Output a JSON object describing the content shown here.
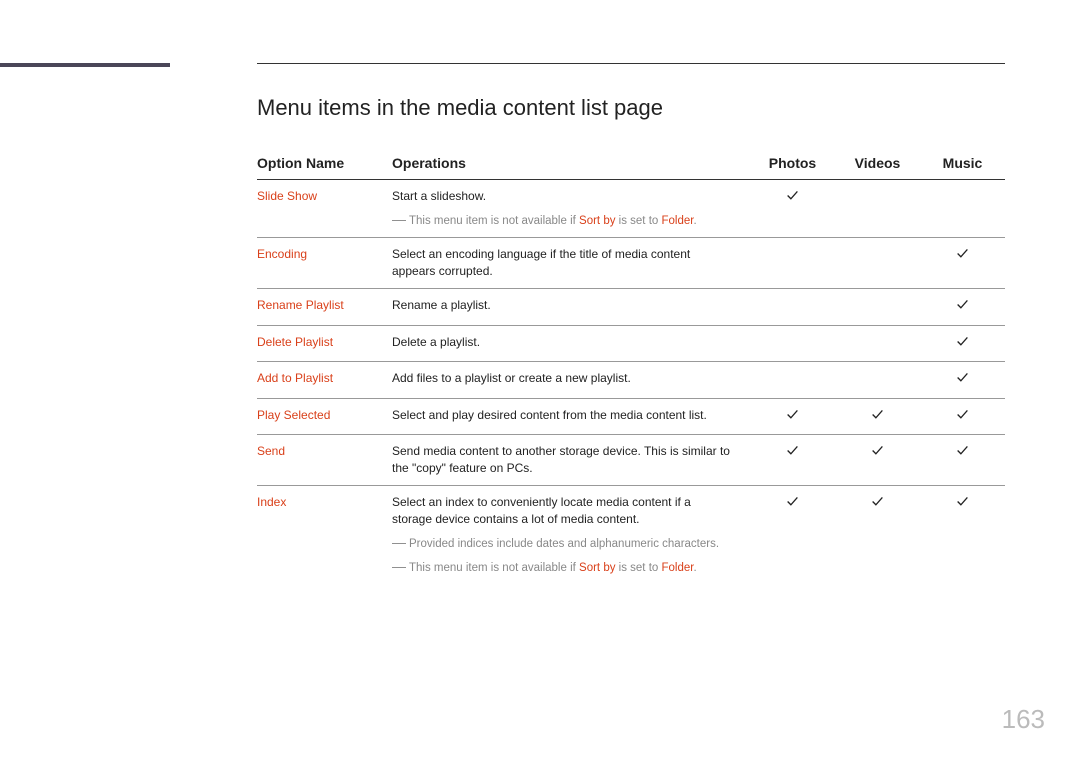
{
  "page": {
    "title": "Menu items in the media content list page",
    "pageNumber": "163"
  },
  "table": {
    "headers": {
      "optionName": "Option Name",
      "operations": "Operations",
      "photos": "Photos",
      "videos": "Videos",
      "music": "Music"
    },
    "rows": [
      {
        "name": "Slide Show",
        "desc": "Start a slideshow.",
        "notes": [
          {
            "prefix": "This menu item is not available if ",
            "hl1": "Sort by",
            "mid": " is set to ",
            "hl2": "Folder",
            "suffix": "."
          }
        ],
        "photos": true,
        "videos": false,
        "music": false
      },
      {
        "name": "Encoding",
        "desc": "Select an encoding language if the title of media content appears corrupted.",
        "notes": [],
        "photos": false,
        "videos": false,
        "music": true
      },
      {
        "name": "Rename Playlist",
        "desc": "Rename a playlist.",
        "notes": [],
        "photos": false,
        "videos": false,
        "music": true
      },
      {
        "name": "Delete Playlist",
        "desc": "Delete a playlist.",
        "notes": [],
        "photos": false,
        "videos": false,
        "music": true
      },
      {
        "name": "Add to Playlist",
        "desc": "Add files to a playlist or create a new playlist.",
        "notes": [],
        "photos": false,
        "videos": false,
        "music": true
      },
      {
        "name": "Play Selected",
        "desc": "Select and play desired content from the media content list.",
        "notes": [],
        "photos": true,
        "videos": true,
        "music": true
      },
      {
        "name": "Send",
        "desc": "Send media content to another storage device. This is similar to the \"copy\" feature on PCs.",
        "notes": [],
        "photos": true,
        "videos": true,
        "music": true
      },
      {
        "name": "Index",
        "desc": "Select an index to conveniently locate media content if a storage device contains a lot of media content.",
        "notes": [
          {
            "prefix": "Provided indices include dates and alphanumeric characters.",
            "hl1": "",
            "mid": "",
            "hl2": "",
            "suffix": ""
          },
          {
            "prefix": "This menu item is not available if ",
            "hl1": "Sort by",
            "mid": " is set to ",
            "hl2": "Folder",
            "suffix": "."
          }
        ],
        "photos": true,
        "videos": true,
        "music": true
      }
    ]
  }
}
